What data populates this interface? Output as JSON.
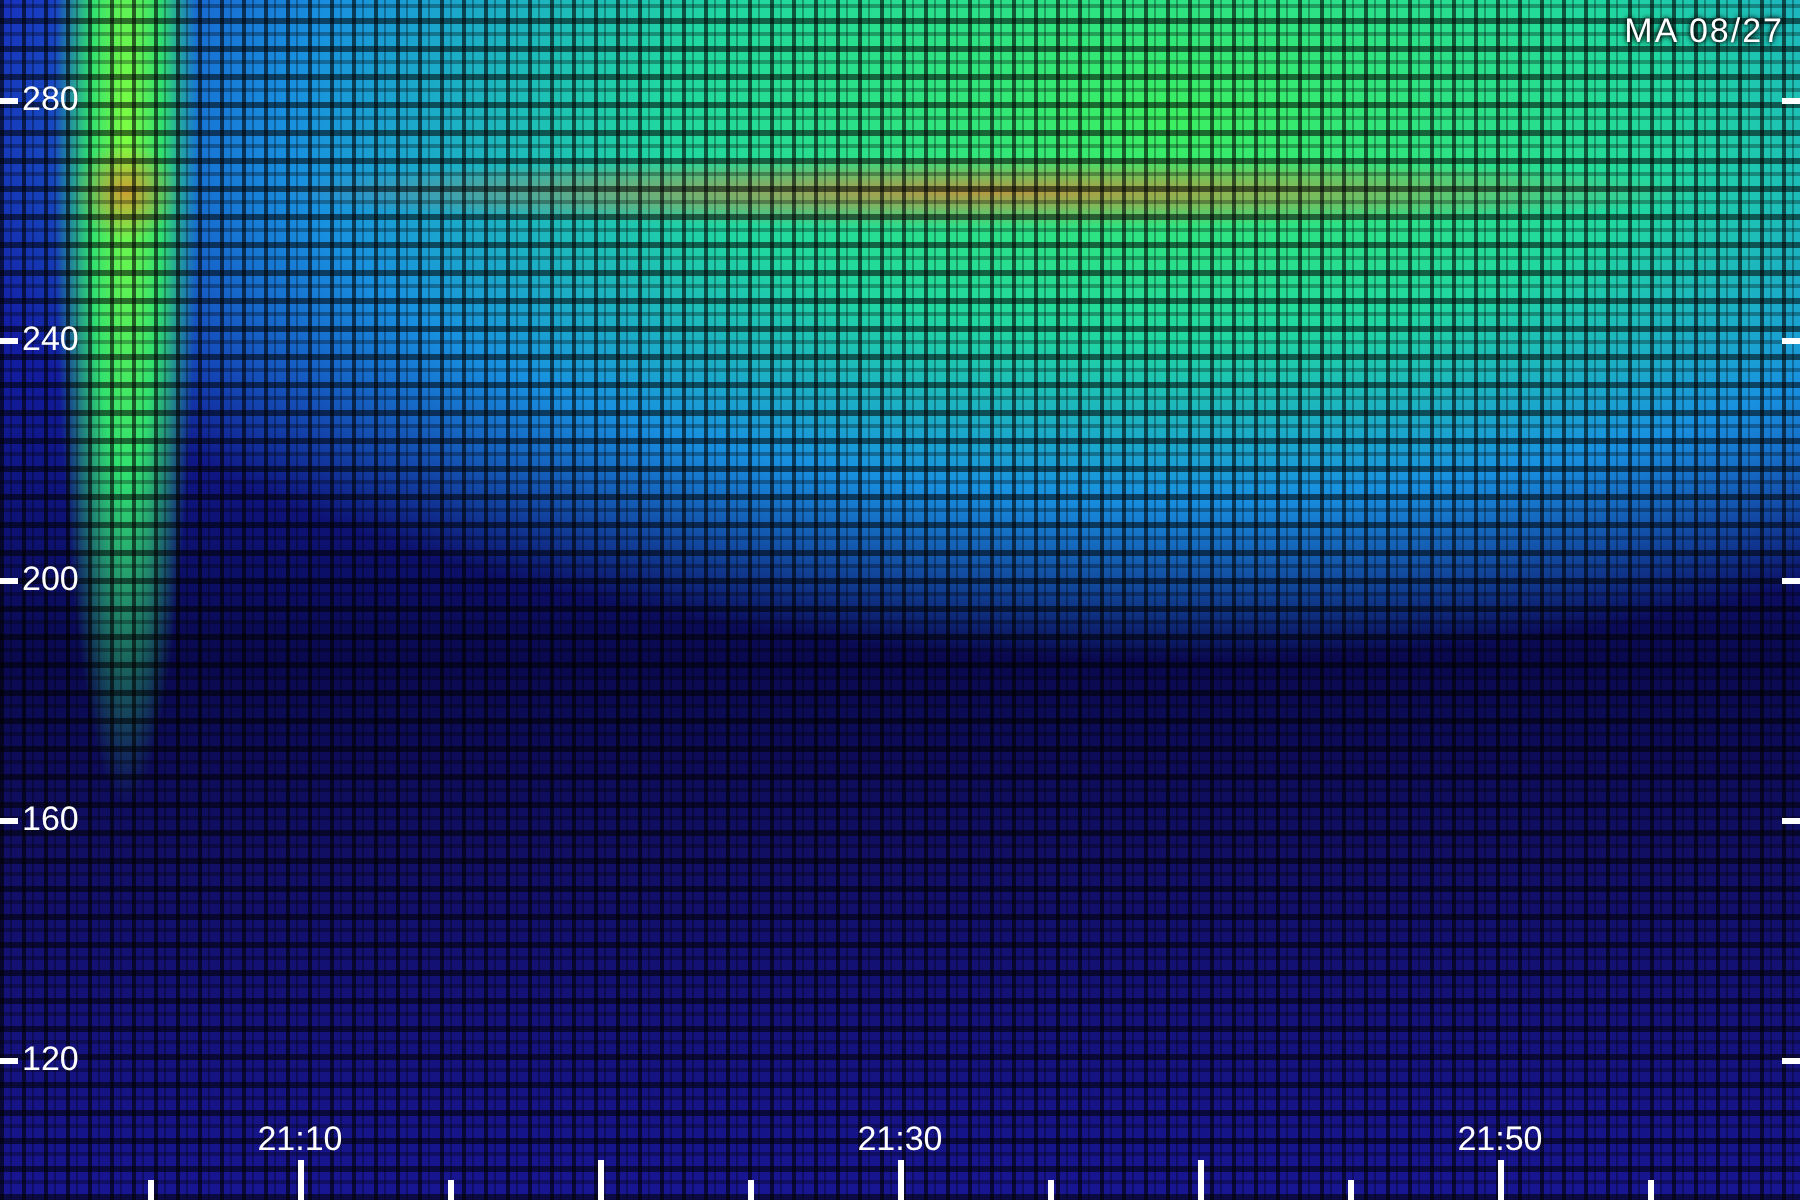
{
  "stamp": "MA 08/27",
  "y_axis": {
    "labels": [
      "280",
      "240",
      "200",
      "160",
      "120"
    ]
  },
  "x_axis": {
    "labels": [
      "21:10",
      "21:30",
      "21:50"
    ]
  }
}
